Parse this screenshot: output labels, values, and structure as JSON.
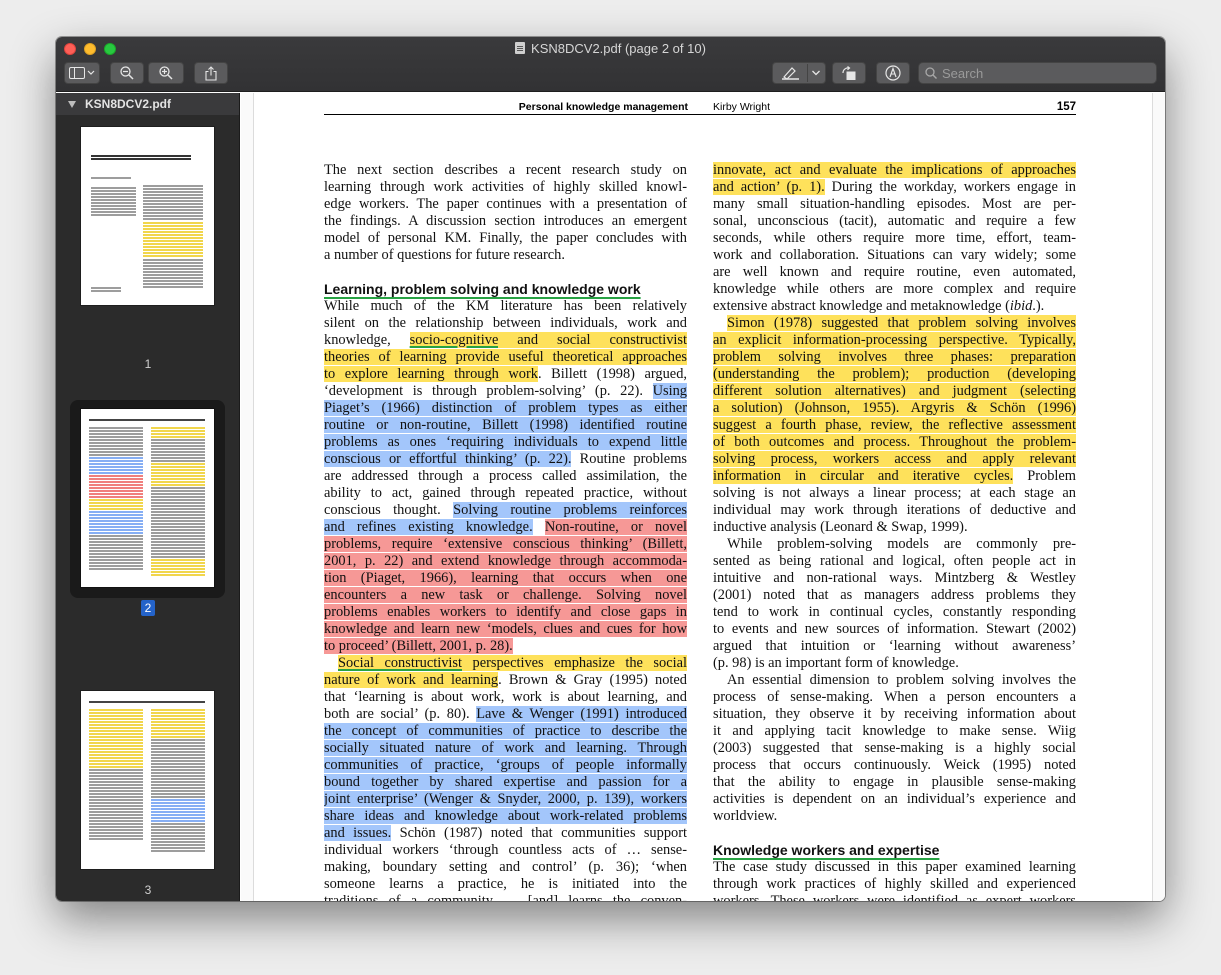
{
  "window": {
    "title": "KSN8DCV2.pdf (page 2 of 10)"
  },
  "toolbar": {
    "search_placeholder": "Search"
  },
  "sidebar": {
    "file_name": "KSN8DCV2.pdf",
    "thumbnails": [
      {
        "label": "1"
      },
      {
        "label": "2"
      },
      {
        "label": "3"
      }
    ]
  },
  "page": {
    "running_title": "Personal knowledge management",
    "running_author": "Kirby Wright",
    "page_number": "157",
    "left_column": [
      {
        "t": "The next section describes a recent research study on"
      },
      {
        "t": "learning through work activities of highly skilled knowl-"
      },
      {
        "t": "edge workers. The paper continues with a presentation of"
      },
      {
        "t": "the findings. A discussion section introduces an emergent"
      },
      {
        "t": "model of personal KM. Finally, the paper concludes with"
      },
      {
        "t": "a number of questions for future research.",
        "last": true
      },
      {
        "space": true
      },
      {
        "heading": "Learning, problem solving and knowledge work"
      },
      {
        "t": "While much of the KM literature has been relatively"
      },
      {
        "t": "silent on the relationship between individuals, work and"
      },
      {
        "segs": [
          {
            "t": "knowledge, "
          },
          {
            "t": "socio-cognitive",
            "h": "y",
            "u": true
          },
          {
            "t": " and social constructivist",
            "h": "y"
          }
        ]
      },
      {
        "segs": [
          {
            "t": "theories of learning provide useful theoretical approaches",
            "h": "y"
          }
        ]
      },
      {
        "segs": [
          {
            "t": "to explore learning through work",
            "h": "y"
          },
          {
            "t": ". Billett (1998) argued,"
          }
        ]
      },
      {
        "segs": [
          {
            "t": "‘development is through problem-solving’ (p. 22). "
          },
          {
            "t": "Using",
            "h": "b"
          }
        ]
      },
      {
        "segs": [
          {
            "t": "Piaget’s (1966) distinction of problem types as either",
            "h": "b"
          }
        ]
      },
      {
        "segs": [
          {
            "t": "routine or non-routine, Billett (1998) identified routine",
            "h": "b"
          }
        ]
      },
      {
        "segs": [
          {
            "t": "problems as ones ‘requiring individuals to expend little",
            "h": "b"
          }
        ]
      },
      {
        "segs": [
          {
            "t": "conscious or effortful thinking’ (p. 22).",
            "h": "b"
          },
          {
            "t": " Routine problems"
          }
        ]
      },
      {
        "t": "are addressed through a process called assimilation, the"
      },
      {
        "t": "ability to act, gained through repeated practice, without"
      },
      {
        "segs": [
          {
            "t": "conscious thought. "
          },
          {
            "t": "Solving routine problems reinforces",
            "h": "b"
          }
        ]
      },
      {
        "segs": [
          {
            "t": "and refines existing knowledge.",
            "h": "b"
          },
          {
            "t": " "
          },
          {
            "t": "Non-routine, or novel",
            "h": "r"
          }
        ]
      },
      {
        "segs": [
          {
            "t": "problems, require ‘extensive conscious thinking’ (Billett,",
            "h": "r"
          }
        ]
      },
      {
        "segs": [
          {
            "t": "2001, p. 22) and extend knowledge through accommoda-",
            "h": "r"
          }
        ]
      },
      {
        "segs": [
          {
            "t": "tion (Piaget, 1966), learning that occurs when one",
            "h": "r"
          }
        ]
      },
      {
        "segs": [
          {
            "t": "encounters a new task or challenge. Solving novel",
            "h": "r"
          }
        ]
      },
      {
        "segs": [
          {
            "t": "problems enables workers to identify and close gaps in",
            "h": "r"
          }
        ]
      },
      {
        "segs": [
          {
            "t": "knowledge and learn new ‘models, clues and cues for how",
            "h": "r"
          }
        ]
      },
      {
        "segs": [
          {
            "t": "to proceed’ (Billett, 2001, p. 28).",
            "h": "r"
          }
        ],
        "last": true
      },
      {
        "segs": [
          {
            "t": "Social constructivist",
            "h": "y",
            "u": true
          },
          {
            "t": " perspectives emphasize the social",
            "h": "y"
          }
        ],
        "ind": true
      },
      {
        "segs": [
          {
            "t": "nature of work and learning",
            "h": "y"
          },
          {
            "t": ". Brown & Gray (1995) noted"
          }
        ]
      },
      {
        "t": "that ‘learning is about work, work is about learning, and"
      },
      {
        "segs": [
          {
            "t": "both are social’ (p. 80). "
          },
          {
            "t": "Lave & Wenger (1991) introduced",
            "h": "b"
          }
        ]
      },
      {
        "segs": [
          {
            "t": "the concept of communities of practice to describe the",
            "h": "b"
          }
        ]
      },
      {
        "segs": [
          {
            "t": "socially situated nature of work and learning. Through",
            "h": "b"
          }
        ]
      },
      {
        "segs": [
          {
            "t": "communities of practice, ‘groups of people informally",
            "h": "b"
          }
        ]
      },
      {
        "segs": [
          {
            "t": "bound together by shared expertise and passion for a",
            "h": "b"
          }
        ]
      },
      {
        "segs": [
          {
            "t": "joint enterprise’ (Wenger & Snyder, 2000, p. 139), workers",
            "h": "b"
          }
        ]
      },
      {
        "segs": [
          {
            "t": "share ideas and knowledge about work-related problems",
            "h": "b"
          }
        ]
      },
      {
        "segs": [
          {
            "t": "and issues.",
            "h": "b"
          },
          {
            "t": " Schön (1987) noted that communities support"
          }
        ]
      },
      {
        "t": "individual workers ‘through countless acts of … sense-"
      },
      {
        "t": "making, boundary setting and control’ (p. 36); ‘when"
      },
      {
        "t": "someone learns a practice, he is initiated into the"
      },
      {
        "t": "traditions of a community … [and] learns the conven-"
      }
    ],
    "right_column": [
      {
        "segs": [
          {
            "t": "innovate, act and evaluate the implications of approaches",
            "h": "y"
          }
        ]
      },
      {
        "segs": [
          {
            "t": "and action’ (p. 1).",
            "h": "y"
          },
          {
            "t": " During the workday, workers engage in"
          }
        ]
      },
      {
        "t": "many small situation-handling episodes. Most are per-"
      },
      {
        "t": "sonal, unconscious (tacit), automatic and require a few"
      },
      {
        "t": "seconds, while others require more time, effort, team-"
      },
      {
        "t": "work and collaboration. Situations can vary widely; some"
      },
      {
        "t": "are well known and require routine, even automated,"
      },
      {
        "t": "knowledge while others are more complex and require"
      },
      {
        "segs": [
          {
            "t": "extensive abstract knowledge and metaknowledge ("
          },
          {
            "t": "ibid",
            "i": true
          },
          {
            "t": ".)."
          }
        ],
        "last": true
      },
      {
        "segs": [
          {
            "t": "Simon (1978) suggested that problem solving involves",
            "h": "y"
          }
        ],
        "ind": true
      },
      {
        "segs": [
          {
            "t": "an explicit information-processing perspective. Typically,",
            "h": "y"
          }
        ]
      },
      {
        "segs": [
          {
            "t": "problem solving involves three phases: preparation",
            "h": "y"
          }
        ]
      },
      {
        "segs": [
          {
            "t": "(understanding the problem); production (developing",
            "h": "y"
          }
        ]
      },
      {
        "segs": [
          {
            "t": "different solution alternatives) and judgment (selecting",
            "h": "y"
          }
        ]
      },
      {
        "segs": [
          {
            "t": "a solution) (Johnson, 1955). Argyris & Schön (1996)",
            "h": "y"
          }
        ]
      },
      {
        "segs": [
          {
            "t": "suggest a fourth phase, review, the reflective assessment",
            "h": "y"
          }
        ]
      },
      {
        "segs": [
          {
            "t": "of both outcomes and process. Throughout the problem-",
            "h": "y"
          }
        ]
      },
      {
        "segs": [
          {
            "t": "solving process, workers access and apply relevant",
            "h": "y"
          }
        ]
      },
      {
        "segs": [
          {
            "t": "information in circular and iterative cycles.",
            "h": "y"
          },
          {
            "t": " Problem"
          }
        ]
      },
      {
        "t": "solving is not always a linear process; at each stage an"
      },
      {
        "t": "individual may work through iterations of deductive and"
      },
      {
        "t": "inductive analysis (Leonard & Swap, 1999).",
        "last": true
      },
      {
        "t": "While problem-solving models are commonly pre-",
        "ind": true
      },
      {
        "t": "sented as being rational and logical, often people act in"
      },
      {
        "t": "intuitive and non-rational ways. Mintzberg & Westley"
      },
      {
        "t": "(2001) noted that as managers address problems they"
      },
      {
        "t": "tend to work in continual cycles, constantly responding"
      },
      {
        "t": "to events and new sources of information. Stewart (2002)"
      },
      {
        "t": "argued that intuition or ‘learning without awareness’"
      },
      {
        "t": "(p. 98) is an important form of knowledge.",
        "last": true
      },
      {
        "t": "An essential dimension to problem solving involves the",
        "ind": true
      },
      {
        "t": "process of sense-making. When a person encounters a"
      },
      {
        "t": "situation, they observe it by receiving information about"
      },
      {
        "t": "it and applying tacit knowledge to make sense. Wiig"
      },
      {
        "t": "(2003) suggested that sense-making is a highly social"
      },
      {
        "t": "process that occurs continuously. Weick (1995) noted"
      },
      {
        "t": "that the ability to engage in plausible sense-making"
      },
      {
        "t": "activities is dependent on an individual’s experience and"
      },
      {
        "t": "worldview.",
        "last": true
      },
      {
        "space": true
      },
      {
        "heading": "Knowledge workers and expertise"
      },
      {
        "t": "The case study discussed in this paper examined learning"
      },
      {
        "t": "through work practices of highly skilled and experienced"
      },
      {
        "t": "workers. These workers were identified as expert workers"
      }
    ]
  }
}
